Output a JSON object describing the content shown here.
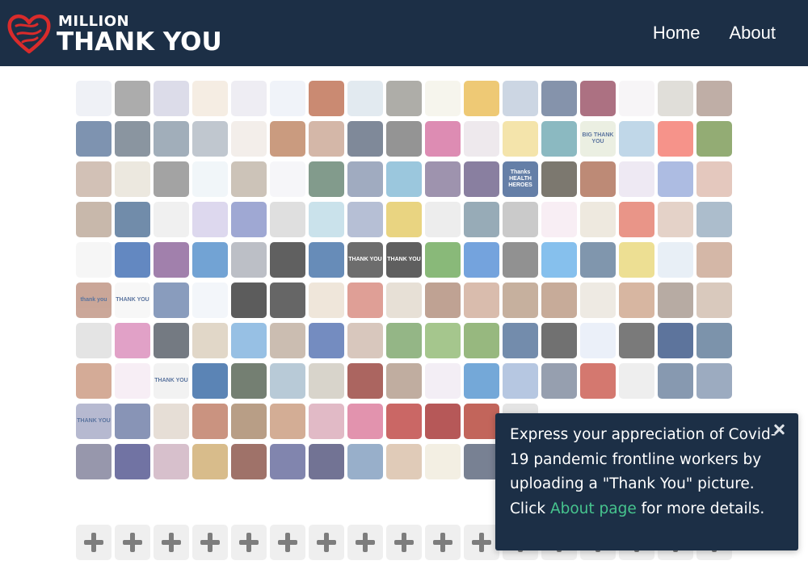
{
  "header": {
    "logo_top": "MILLION",
    "logo_bottom": "THANK YOU",
    "nav": [
      {
        "label": "Home"
      },
      {
        "label": "About"
      }
    ]
  },
  "colors": {
    "header_bg": "#1c2f46",
    "heart": "#d92b2b",
    "link": "#46c48e"
  },
  "grid": {
    "columns": 17,
    "rows": 12,
    "photo_tiles": [
      "#e9ecf2",
      "#8c8c8c",
      "#cfcfe0",
      "#f1e6d8",
      "#e8e6ee",
      "#eaeff6",
      "#b55d3c",
      "#d7e2ea",
      "#8f8d86",
      "#f3f1e6",
      "#e8b440",
      "#b9c6d8",
      "#566a8a",
      "#8c3a52",
      "#f4f1f4",
      "#d4d1cb",
      "#a68f83",
      "#4c6a92",
      "#5d6c7c",
      "#7d8fa0",
      "#a7b1bd",
      "#eee8e2",
      "#b5754e",
      "#c39b86",
      "#4e5b72",
      "#6b6b6b",
      "#d05f95",
      "#e8e0e6",
      "#f0d98b",
      "#5e9ea9",
      "#e4e9d8",
      "#a7c7df",
      "#f26a5d",
      "#6a8c3e",
      "#c1a99a",
      "#e5dfd3",
      "#808080",
      "#ecf2f6",
      "#b8ac9c",
      "#f2f2f6",
      "#52755f",
      "#7b8aa8",
      "#74b1d0",
      "#786a8f",
      "#5b4d7b",
      "#2a4f86",
      "#4a4438",
      "#a35d41",
      "#e7e1ef",
      "#8da2d7",
      "#d9b3a5",
      "#b39d8a",
      "#3a5f89",
      "#eaeaea",
      "#d0c9e8",
      "#7a86c2",
      "#d3d3d3",
      "#b6d7e3",
      "#9aa6c5",
      "#e0c350",
      "#e6e6e6",
      "#6f8b9b",
      "#b6b6b6",
      "#f5e7f0",
      "#e8e0d2",
      "#e06c5a",
      "#d9c1b3",
      "#8ca4b8",
      "#f2f2f2",
      "#275aa9",
      "#7d4f8c",
      "#3b7fc3",
      "#a2a6b0",
      "#222222",
      "#2d5f9c",
      "#363636",
      "#222222",
      "#5b9e45",
      "#3e7fd0",
      "#666666",
      "#58a8e6",
      "#4f6e8d",
      "#e6d36a",
      "#dfe9f3",
      "#c49b85",
      "#b78571",
      "#f4f4f4",
      "#5b76a3",
      "#eef3f8",
      "#1d1d1d",
      "#2b2b2b",
      "#e9dccc",
      "#d27a6e",
      "#ded4c6",
      "#a67e6a",
      "#caa28d",
      "#b09179",
      "#b28a72",
      "#e8e2d8",
      "#c89a7d",
      "#9b8a80",
      "#cab4a3",
      "#d9d9d9",
      "#d57db2",
      "#3f4752",
      "#d6c8b3",
      "#6fa8d9",
      "#b7a393",
      "#3e5fa8",
      "#c9b2a4",
      "#6b9a58",
      "#82b061",
      "#6f9d4e",
      "#3d5f8c",
      "#3a3a3a",
      "#e3eaf6",
      "#474747",
      "#1e3f76",
      "#4a6a8a",
      "#c38a6f",
      "#f4e8f1",
      "#eeeeee",
      "#1c5498",
      "#3e4d3c",
      "#9cb6c8",
      "#c9c3b7",
      "#8a2a22",
      "#a78d7b",
      "#efe7f1",
      "#3f86c9",
      "#9ab2d5",
      "#6d7a90",
      "#c44438",
      "#e8e8e8",
      "#597192",
      "#768aa8",
      "#9b9fbf",
      "#5a6b9a",
      "#dcd1c6",
      "#b5694f",
      "#9d7858",
      "#c28d6c",
      "#d6a0b0",
      "#d76a8f",
      "#b62d2a",
      "#9a1818",
      "#aa2a1c",
      "#d9d9d9",
      "#ffffff",
      "#ffffff",
      "#ffffff",
      "#ffffff",
      "#ffffff",
      "#6f6f8c",
      "#3a3d7f",
      "#c8a7b8",
      "#c9a25e",
      "#7a3c2f",
      "#50568f",
      "#3b3d6b",
      "#7090b5",
      "#d4b79c",
      "#efe9d8",
      "#44506a"
    ],
    "photo_labels": [
      {
        "index": 75,
        "text": "THANK YOU"
      },
      {
        "index": 76,
        "text": "THANK YOU"
      },
      {
        "index": 85,
        "text": "thank you"
      },
      {
        "index": 86,
        "text": "THANK YOU"
      },
      {
        "index": 30,
        "text": "BIG THANK YOU"
      },
      {
        "index": 45,
        "text": "Thanks HEALTH HEROES"
      },
      {
        "index": 121,
        "text": "THANK YOU"
      },
      {
        "index": 136,
        "text": "THANK YOU"
      }
    ],
    "add_tiles_start": 181
  },
  "popup": {
    "text_before": "Express your appreciation of Covid-19 pandemic frontline workers by uploading a \"Thank You\" picture. Click ",
    "link_text": "About page",
    "text_after": " for more details.",
    "close_icon": "close-icon"
  }
}
